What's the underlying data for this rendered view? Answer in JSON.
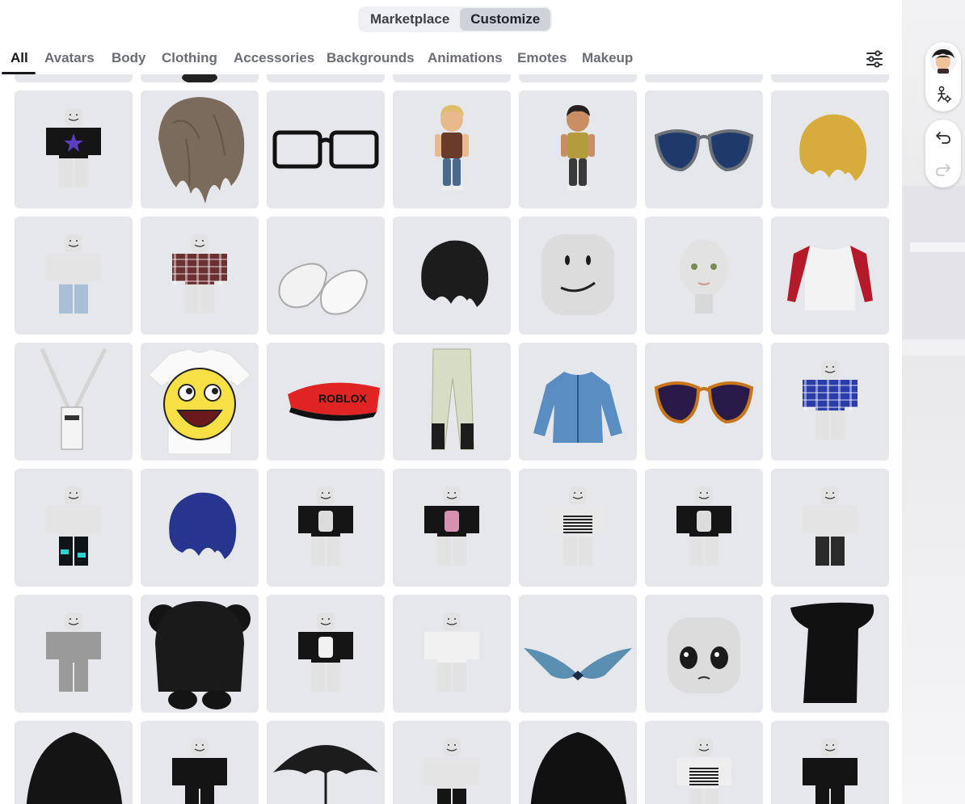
{
  "segment": {
    "items": [
      {
        "label": "Marketplace",
        "active": false
      },
      {
        "label": "Customize",
        "active": true
      }
    ]
  },
  "tabs": [
    {
      "label": "All",
      "active": true
    },
    {
      "label": "Avatars"
    },
    {
      "label": "Body"
    },
    {
      "label": "Clothing"
    },
    {
      "label": "Accessories"
    },
    {
      "label": "Backgrounds"
    },
    {
      "label": "Animations"
    },
    {
      "label": "Emotes"
    },
    {
      "label": "Makeup"
    }
  ],
  "grid": {
    "rows": [
      [
        {
          "kind": "partial"
        },
        {
          "kind": "partial-dark"
        },
        {
          "kind": "partial"
        },
        {
          "kind": "partial"
        },
        {
          "kind": "partial"
        },
        {
          "kind": "partial"
        },
        {
          "kind": "partial"
        }
      ],
      [
        {
          "kind": "avatar",
          "torso": "#151515",
          "legs": "#e2e2e2",
          "star": "#5b3fc0"
        },
        {
          "kind": "hair",
          "color": "#7b6b5c"
        },
        {
          "kind": "glasses"
        },
        {
          "kind": "figure",
          "skin": "#e7b98d",
          "hair": "#e0bd6a",
          "shirt": "#6a3a2a",
          "pants": "#4b6a8b"
        },
        {
          "kind": "figure",
          "skin": "#c98e63",
          "hair": "#262020",
          "shirt": "#b49c3c",
          "pants": "#3a3a3a"
        },
        {
          "kind": "sunglasses",
          "lens": "#1e3a6b",
          "frame": "#6c7078"
        },
        {
          "kind": "hair-small",
          "color": "#d8ac3c"
        }
      ],
      [
        {
          "kind": "avatar",
          "torso": "#e4e4e4",
          "legs": "#a9bfd6"
        },
        {
          "kind": "avatar",
          "torso": "#6b3030",
          "legs": "#e2e2e2",
          "plaid": true
        },
        {
          "kind": "shoes"
        },
        {
          "kind": "hair-small",
          "color": "#1c1c1c"
        },
        {
          "kind": "head",
          "face": "smile"
        },
        {
          "kind": "realhead"
        },
        {
          "kind": "longsleeve"
        }
      ],
      [
        {
          "kind": "lanyard"
        },
        {
          "kind": "tshirt"
        },
        {
          "kind": "visor",
          "text": "ROBLOX"
        },
        {
          "kind": "pants"
        },
        {
          "kind": "jacket"
        },
        {
          "kind": "sunglasses",
          "lens": "#2a1a4a",
          "frame": "#c8761a"
        },
        {
          "kind": "avatar",
          "torso": "#2b3ea8",
          "legs": "#e2e2e2",
          "plaid": true
        }
      ],
      [
        {
          "kind": "avatar",
          "torso": "#e4e4e4",
          "legs": "#0f1418",
          "teal": true
        },
        {
          "kind": "hair-small",
          "color": "#27358f"
        },
        {
          "kind": "avatar",
          "torso": "#151515",
          "legs": "#e2e2e2",
          "print": "#dcdcdc"
        },
        {
          "kind": "avatar",
          "torso": "#151515",
          "legs": "#e2e2e2",
          "print": "#d890b0"
        },
        {
          "kind": "avatar",
          "torso": "#e8e8e8",
          "legs": "#e2e2e2",
          "stripes": true
        },
        {
          "kind": "avatar",
          "torso": "#151515",
          "legs": "#e2e2e2",
          "print": "#dcdcdc"
        },
        {
          "kind": "avatar",
          "torso": "#e4e4e4",
          "legs": "#2a2a2a"
        }
      ],
      [
        {
          "kind": "avatar",
          "torso": "#9a9a9a",
          "legs": "#9a9a9a"
        },
        {
          "kind": "bearhat"
        },
        {
          "kind": "avatar",
          "torso": "#151515",
          "legs": "#e2e2e2",
          "print": "#f2f2f2"
        },
        {
          "kind": "avatar",
          "torso": "#f1f1f1",
          "legs": "#e2e2e2"
        },
        {
          "kind": "wings"
        },
        {
          "kind": "head",
          "face": "anime"
        },
        {
          "kind": "scarf"
        }
      ],
      [
        {
          "kind": "hair-big",
          "color": "#141414"
        },
        {
          "kind": "avatar",
          "torso": "#141414",
          "legs": "#141414"
        },
        {
          "kind": "umbrella"
        },
        {
          "kind": "avatar",
          "torso": "#e4e4e4",
          "legs": "#141414"
        },
        {
          "kind": "hair-big",
          "color": "#111111"
        },
        {
          "kind": "avatar",
          "torso": "#eeeeee",
          "legs": "#e2e2e2",
          "stripes": true
        },
        {
          "kind": "avatar",
          "torso": "#141414",
          "legs": "#141414"
        }
      ]
    ]
  },
  "colors": {
    "tile_bg": "#e6e7eb",
    "text_active": "#16181d",
    "text_muted": "#6a6d75"
  },
  "icons": {
    "filter": "sliders-icon",
    "avatar_thumb": "avatar-thumbnail",
    "avatar_settings": "avatar-settings-icon",
    "undo": "undo-icon",
    "redo": "redo-icon"
  }
}
